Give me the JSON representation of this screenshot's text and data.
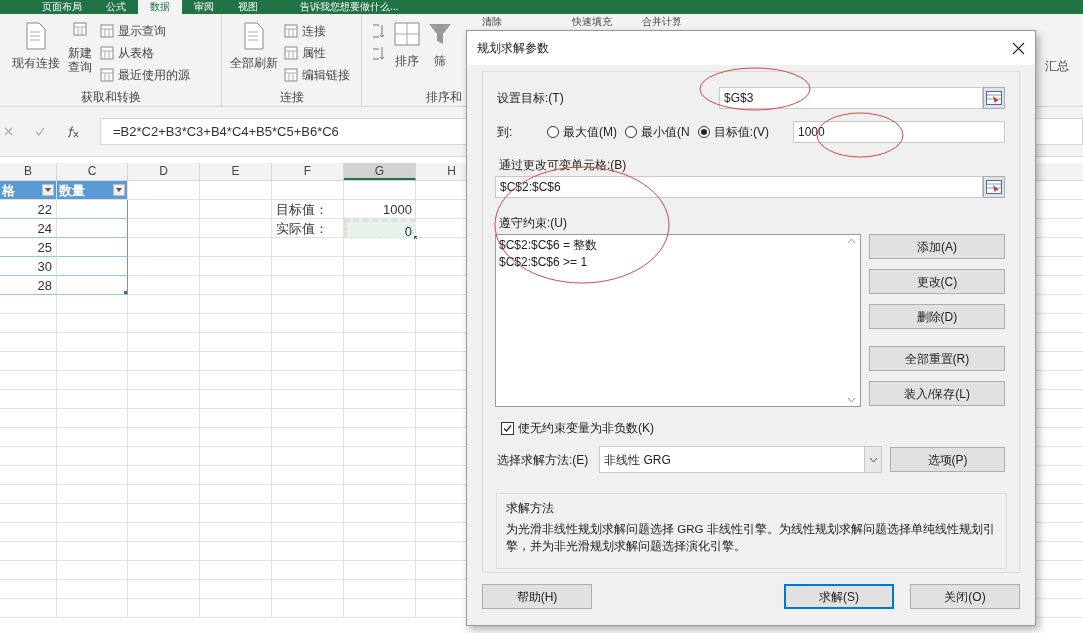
{
  "ribbon": {
    "tabs": [
      {
        "label": "页面布局",
        "selected": false
      },
      {
        "label": "公式",
        "selected": false
      },
      {
        "label": "数据",
        "selected": true
      },
      {
        "label": "审阅",
        "selected": false
      },
      {
        "label": "视图",
        "selected": false
      }
    ],
    "tell_me": "告诉我您想要做什么...",
    "existing_connections": "现有连接",
    "new_query": [
      "新建",
      "查询"
    ],
    "query_items": [
      "显示查询",
      "从表格",
      "最近使用的源"
    ],
    "get_transform_label": "获取和转换",
    "refresh_all": "全部刷新",
    "connection_items": [
      "连接",
      "属性",
      "编辑链接"
    ],
    "connections_label": "连接",
    "sort": "排序",
    "filter": "筛",
    "sort_label": "排序和",
    "clear": "清除",
    "flash_fill": "快速填充",
    "consolidate": "合并计算",
    "subtotal": "汇总"
  },
  "formula_bar": {
    "formula": "=B2*C2+B3*C3+B4*C4+B5*C5+B6*C6"
  },
  "sheet": {
    "columns": [
      {
        "label": "B",
        "selected": false
      },
      {
        "label": "C",
        "selected": false
      },
      {
        "label": "D",
        "selected": false
      },
      {
        "label": "E",
        "selected": false
      },
      {
        "label": "F",
        "selected": false
      },
      {
        "label": "G",
        "selected": true
      },
      {
        "label": "H",
        "selected": false
      }
    ],
    "table": {
      "headers": [
        "格",
        "数量"
      ],
      "values": [
        "22",
        "24",
        "25",
        "30",
        "28"
      ]
    },
    "targets": [
      {
        "label": "目标值：",
        "value": "1000",
        "selected": false
      },
      {
        "label": "实际值：",
        "value": "0",
        "selected": true
      }
    ]
  },
  "dialog": {
    "title": "规划求解参数",
    "objective": {
      "label": "设置目标:(T)",
      "value": "$G$3"
    },
    "to": {
      "label": "到:",
      "options": [
        {
          "label": "最大值(M)",
          "selected": false
        },
        {
          "label": "最小值(N",
          "selected": false
        },
        {
          "label": "目标值:(V)",
          "selected": true
        }
      ],
      "value": "1000"
    },
    "changing_cells": {
      "label": "通过更改可变单元格:(B)",
      "value": "$C$2:$C$6"
    },
    "constraints": {
      "label": "遵守约束:(U)",
      "items": [
        "$C$2:$C$6 = 整数",
        "$C$2:$C$6 >= 1"
      ]
    },
    "edit_buttons": [
      "添加(A)",
      "更改(C)",
      "删除(D)"
    ],
    "file_buttons": [
      "全部重置(R)",
      "装入/保存(L)"
    ],
    "nonnegative": {
      "label": "使无约束变量为非负数(K)",
      "checked": true
    },
    "method": {
      "label": "选择求解方法:(E)",
      "value": "非线性 GRG",
      "options_button": "选项(P)"
    },
    "method_info": {
      "title": "求解方法",
      "text": "为光滑非线性规划求解问题选择 GRG 非线性引擎。为线性规划求解问题选择单纯线性规划引擎，并为非光滑规划求解问题选择演化引擎。"
    },
    "footer_buttons": [
      {
        "label": "帮助(H)",
        "focused": false
      },
      {
        "label": "求解(S)",
        "focused": true
      },
      {
        "label": "关闭(O)",
        "focused": false
      }
    ]
  }
}
